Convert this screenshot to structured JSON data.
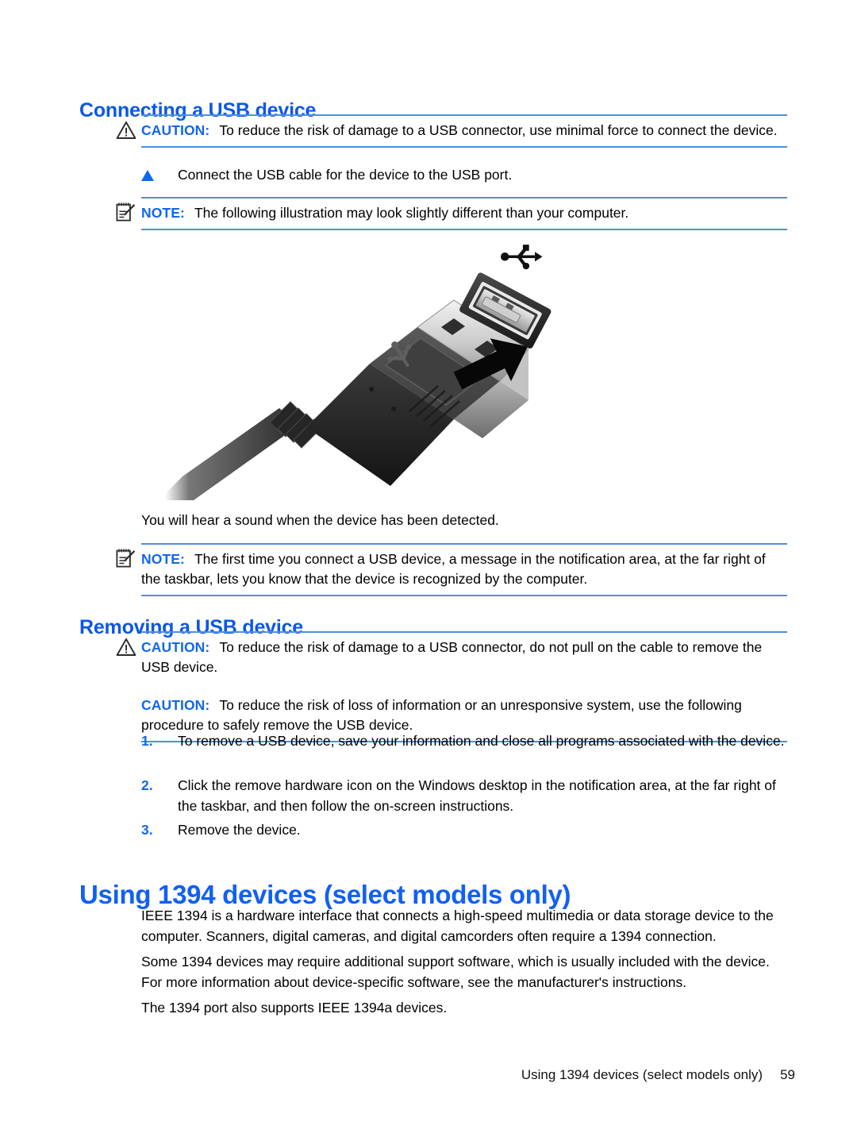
{
  "document": {
    "sections": [
      {
        "heading": "Connecting a USB device",
        "caution": {
          "keyword": "CAUTION:",
          "text": "To reduce the risk of damage to a USB connector, use minimal force to connect the device.",
          "icon": "warning-triangle-icon"
        },
        "step": {
          "bullet": "triangle-bullet-icon",
          "text": "Connect the USB cable for the device to the USB port."
        },
        "note_before_figure": {
          "keyword": "NOTE:",
          "text": "The following illustration may look slightly different than your computer.",
          "icon": "note-pad-pencil-icon"
        },
        "figure": {
          "name": "usb-cable-and-port-illustration",
          "usb_symbol": "usb-trident-icon"
        },
        "after_figure_text": "You will hear a sound when the device has been detected.",
        "note_after_figure": {
          "keyword": "NOTE:",
          "text": "The first time you connect a USB device, a message in the notification area, at the far right of the taskbar, lets you know that the device is recognized by the computer.",
          "icon": "note-pad-pencil-icon"
        }
      },
      {
        "heading": "Removing a USB device",
        "caution_1": {
          "keyword": "CAUTION:",
          "text": "To reduce the risk of damage to a USB connector, do not pull on the cable to remove the USB device.",
          "icon": "warning-triangle-icon"
        },
        "caution_2": {
          "keyword": "CAUTION:",
          "text": "To reduce the risk of loss of information or an unresponsive system, use the following procedure to safely remove the USB device."
        },
        "steps": [
          {
            "number": "1.",
            "text": "To remove a USB device, save your information and close all programs associated with the device."
          },
          {
            "number": "2.",
            "text": "Click the remove hardware icon on the Windows desktop in the notification area, at the far right of the taskbar, and then follow the on-screen instructions."
          },
          {
            "number": "3.",
            "text": "Remove the device."
          }
        ]
      },
      {
        "heading": "Using 1394 devices (select models only)",
        "paragraphs": [
          "IEEE 1394 is a hardware interface that connects a high-speed multimedia or data storage device to the computer. Scanners, digital cameras, and digital camcorders often require a 1394 connection.",
          "Some 1394 devices may require additional support software, which is usually included with the device. For more information about device-specific software, see the manufacturer's instructions.",
          "The 1394 port also supports IEEE 1394a devices."
        ]
      }
    ]
  },
  "footer": {
    "title": "Using 1394 devices (select models only)",
    "page_number": "59"
  },
  "colors": {
    "heading_blue": "#1160f4",
    "keyword_blue": "#1166ee",
    "rule_blue": "#4d90e0"
  }
}
